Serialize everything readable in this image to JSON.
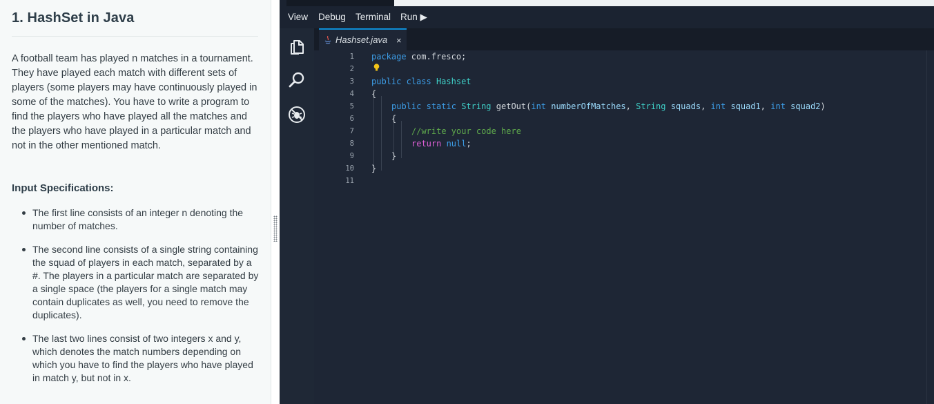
{
  "problem": {
    "title": "1. HashSet in Java",
    "description": "A football team has played n matches in a tournament. They have played each match with different sets of players (some players may have continuously played in some of the matches). You have to write a program to find the players who have played all the matches and the players who have played in a particular match and not in the other mentioned match.",
    "input_heading": "Input Specifications:",
    "items": [
      {
        "text": "The first line consists of an integer n denoting the number of matches."
      },
      {
        "text": "The second line consists of a single string containing the squad of players in each match, separated by a #. The players in a particular match are separated by a single space (the players for a single match may contain duplicates as well, you need to remove the duplicates)."
      },
      {
        "text": "The last two lines consist of two integers x and y, which denotes the match numbers depending on which you have to find the players who have played in match y, but not in x."
      }
    ]
  },
  "menu": {
    "view": "View",
    "debug": "Debug",
    "terminal": "Terminal",
    "run": "Run ▶"
  },
  "activity": [
    "explorer-icon",
    "search-icon",
    "debug-disabled-icon"
  ],
  "editor": {
    "tab_label": "Hashset.java",
    "tab_close": "×",
    "line_numbers": [
      "1",
      "2",
      "3",
      "4",
      "5",
      "6",
      "7",
      "8",
      "9",
      "10",
      "11"
    ],
    "code": {
      "l1_kw": "package",
      "l1_rest": " com.fresco;",
      "l3_kw1": "public",
      "l3_kw2": "class",
      "l3_cls": "Hashset",
      "l4": "{",
      "l5_kw1": "public",
      "l5_kw2": "static",
      "l5_type": "String",
      "l5_name": "getOut(",
      "l5_p1t": "int",
      "l5_p1": "numberOfMatches",
      "l5_c1": ", ",
      "l5_p2t": "String",
      "l5_p2": "squads",
      "l5_c2": ", ",
      "l5_p3t": "int",
      "l5_p3": "squad1",
      "l5_c3": ", ",
      "l5_p4t": "int",
      "l5_p4": "squad2",
      "l5_end": ")",
      "l6": "{",
      "l7": "//write your code here",
      "l8_kw": "return",
      "l8_rest": " null",
      "l8_semi": ";",
      "l9": "}",
      "l10": "}"
    }
  },
  "colors": {
    "ide_bg": "#1e2635",
    "tab_accent": "#0d8fd8",
    "keyword": "#3d9ee8",
    "type": "#3fd0c8",
    "comment": "#5fa94c",
    "return_kw": "#e060d8"
  }
}
